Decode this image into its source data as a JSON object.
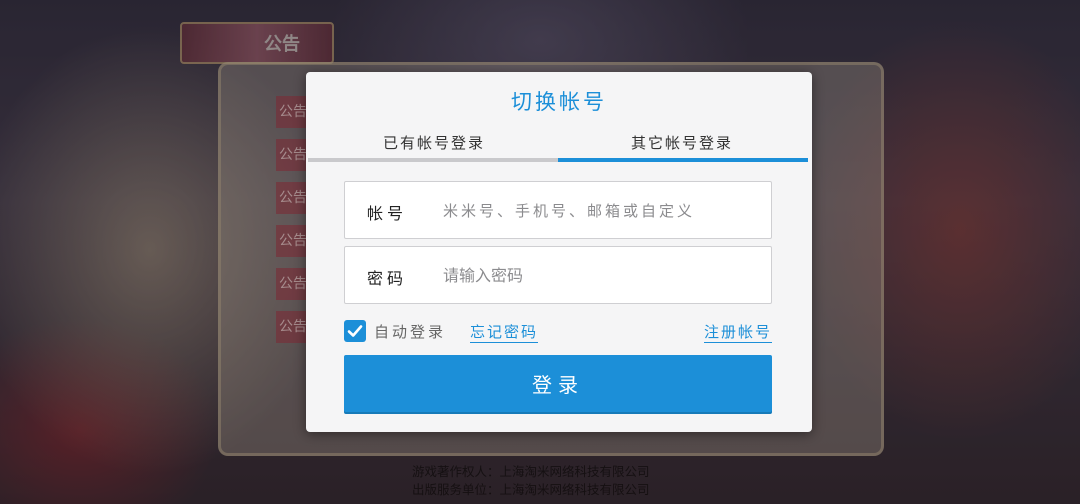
{
  "background": {
    "notice_title": "公告",
    "notice_tabs": [
      "公告",
      "公告",
      "公告",
      "公告",
      "公告",
      "公告"
    ],
    "credits": [
      "游戏著作权人：上海淘米网络科技有限公司",
      "出版服务单位：上海淘米网络科技有限公司"
    ]
  },
  "dialog": {
    "title": "切换帐号",
    "tabs": [
      {
        "label": "已有帐号登录",
        "active": false
      },
      {
        "label": "其它帐号登录",
        "active": true
      }
    ],
    "account": {
      "label": "帐号",
      "value": "",
      "placeholder": "米米号、手机号、邮箱或自定义"
    },
    "password": {
      "label": "密码",
      "value": "",
      "placeholder": "请输入密码"
    },
    "auto_login": {
      "label": "自动登录",
      "checked": true
    },
    "forgot_password": "忘记密码",
    "register": "注册帐号",
    "login_button": "登录"
  },
  "colors": {
    "accent": "#1c8fd8",
    "dialog_bg": "#f5f5f6",
    "inactive_tab_bar": "#c9c9cc"
  }
}
